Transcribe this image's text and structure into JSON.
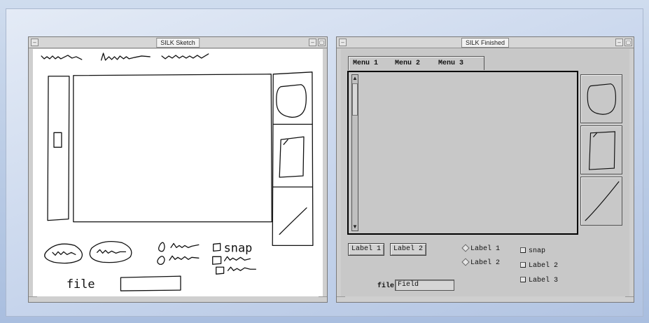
{
  "sketch_window": {
    "title": "SILK Sketch",
    "min_glyph": "–",
    "max_glyph": "▢",
    "snap_label": "snap",
    "file_label": "file"
  },
  "finished_window": {
    "title": "SILK Finished",
    "min_glyph": "–",
    "max_glyph": "▢",
    "menus": [
      "Menu 1",
      "Menu 2",
      "Menu 3"
    ],
    "scroll_up_glyph": "▲",
    "scroll_down_glyph": "▼",
    "buttons": [
      "Label 1",
      "Label 2"
    ],
    "radios": [
      "Label 1",
      "Label 2"
    ],
    "checkboxes": [
      "snap",
      "Label 2",
      "Label 3"
    ],
    "file_label": "file",
    "field_value": "Field"
  }
}
